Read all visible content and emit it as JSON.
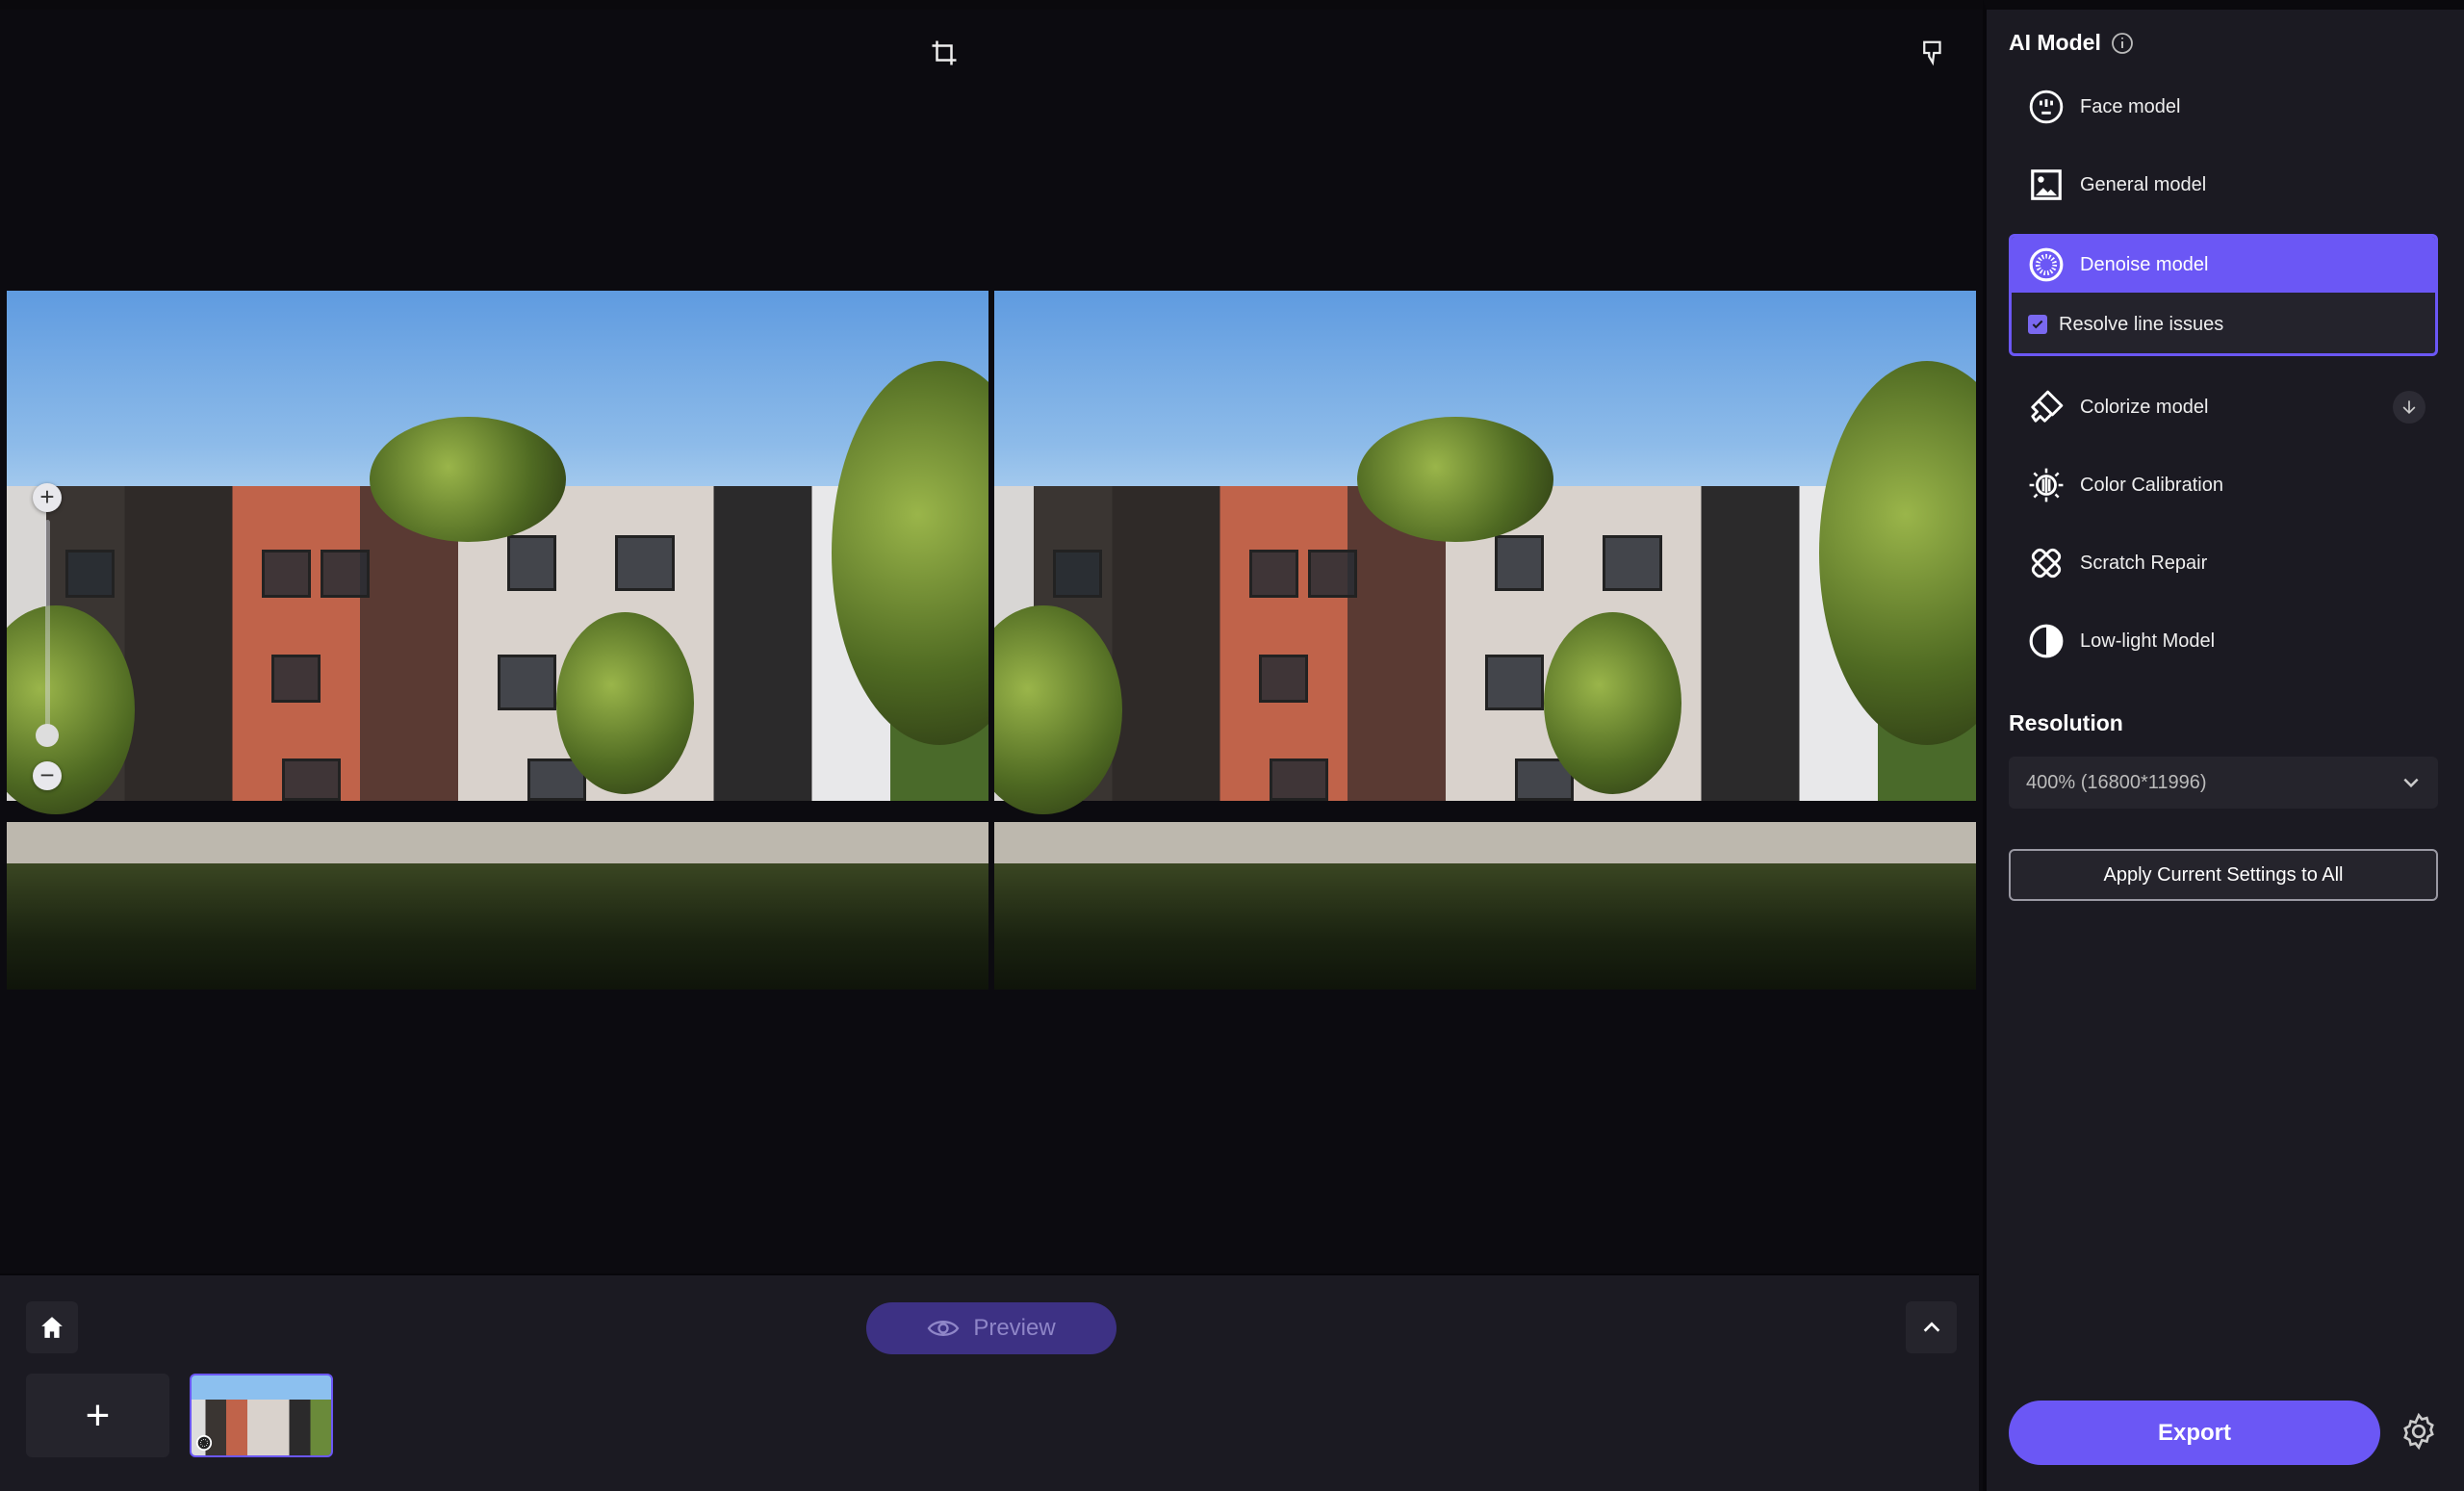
{
  "toolbar": {
    "crop_icon": "crop-icon",
    "feedback_icon": "thumbs-down-icon"
  },
  "viewer": {
    "zoom_in_label": "+",
    "zoom_out_label": "−"
  },
  "bottom": {
    "preview_label": "Preview",
    "add_label": "+"
  },
  "panel": {
    "ai_model_title": "AI Model",
    "models": [
      {
        "label": "Face model",
        "icon": "face-icon"
      },
      {
        "label": "General model",
        "icon": "image-icon"
      },
      {
        "label": "Denoise model",
        "icon": "denoise-icon",
        "selected": true
      },
      {
        "label": "Colorize model",
        "icon": "paint-roller-icon",
        "downloadable": true
      },
      {
        "label": "Color Calibration",
        "icon": "sun-icon"
      },
      {
        "label": "Scratch Repair",
        "icon": "bandage-icon"
      },
      {
        "label": "Low-light Model",
        "icon": "half-circle-icon"
      }
    ],
    "resolve_line_issues": {
      "label": "Resolve line issues",
      "checked": true
    },
    "resolution_title": "Resolution",
    "resolution_value": "400% (16800*11996)",
    "apply_label": "Apply Current Settings to All",
    "export_label": "Export"
  },
  "colors": {
    "accent": "#6b57f5",
    "panel_bg": "#1b1a22",
    "canvas_bg": "#0c0b10",
    "preview_bg": "#3d3184"
  }
}
